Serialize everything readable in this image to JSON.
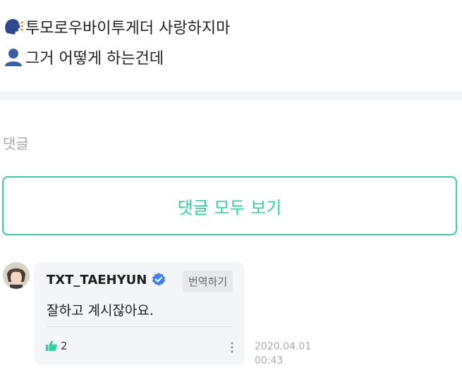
{
  "post": {
    "lines": [
      {
        "icon": "speaking-head-icon",
        "text": "투모로우바이투게더 사랑하지마"
      },
      {
        "icon": "bust-silhouette-icon",
        "text": "그거 어떻게 하는건데"
      }
    ]
  },
  "comments": {
    "heading": "댓글",
    "view_all_label": "댓글 모두 보기",
    "items": [
      {
        "author": "TXT_TAEHYUN",
        "verified": true,
        "translate_label": "번역하기",
        "text": "잘하고 계시잖아요.",
        "likes": "2",
        "date": "2020.04.01",
        "time": "00:43"
      }
    ]
  },
  "colors": {
    "accent": "#2ed3a4",
    "bubble_bg": "#f4f5f8",
    "verified": "#3b82f6",
    "muted": "#a6a6a6"
  }
}
